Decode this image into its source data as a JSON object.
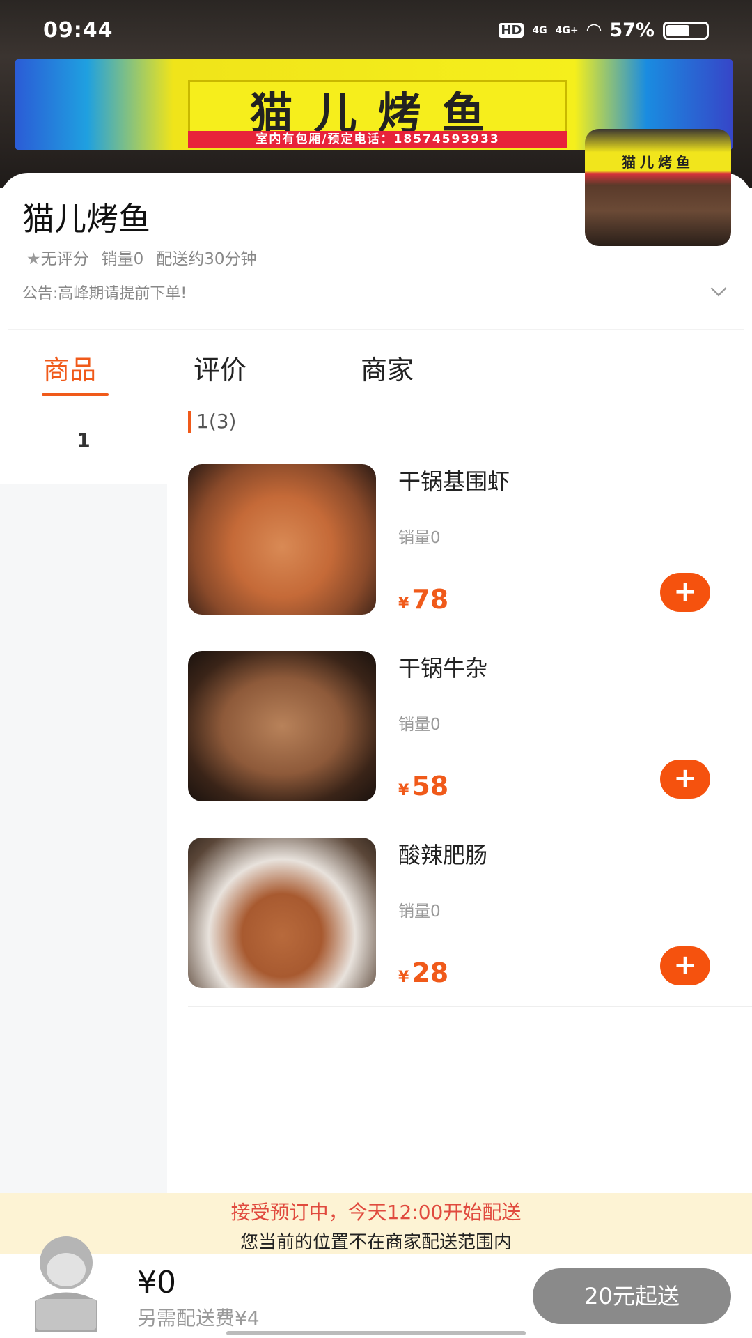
{
  "status_bar": {
    "time": "09:44",
    "hd": "HD",
    "net1": "4G",
    "net2": "4G+",
    "battery": "57%",
    "battery_level": 0.57
  },
  "banner": {
    "sign_text": "猫儿烤鱼",
    "sign_strip": "室内有包厢/预定电话：18574593933"
  },
  "shop": {
    "name": "猫儿烤鱼",
    "rating": "无评分",
    "sales": "销量0",
    "delivery_time": "配送约30分钟",
    "notice": "公告:高峰期请提前下单!",
    "thumb_text": "猫儿烤鱼"
  },
  "tabs": [
    {
      "label": "商品",
      "active": true
    },
    {
      "label": "评价"
    },
    {
      "label": "商家"
    }
  ],
  "accent": "#f05a1a",
  "sidebar": {
    "items": [
      {
        "label": "1"
      }
    ]
  },
  "section": {
    "title": "1(3)"
  },
  "products": [
    {
      "name": "干锅基围虾",
      "sold": "销量0",
      "currency": "¥",
      "price": "78"
    },
    {
      "name": "干锅牛杂",
      "sold": "销量0",
      "currency": "¥",
      "price": "58"
    },
    {
      "name": "酸辣肥肠",
      "sold": "销量0",
      "currency": "¥",
      "price": "28"
    }
  ],
  "tip": {
    "line1": "接受预订中，今天12:00开始配送",
    "line2": "您当前的位置不在商家配送范围内"
  },
  "cart": {
    "total": "¥0",
    "fee": "另需配送费¥4",
    "checkout": "20元起送"
  }
}
